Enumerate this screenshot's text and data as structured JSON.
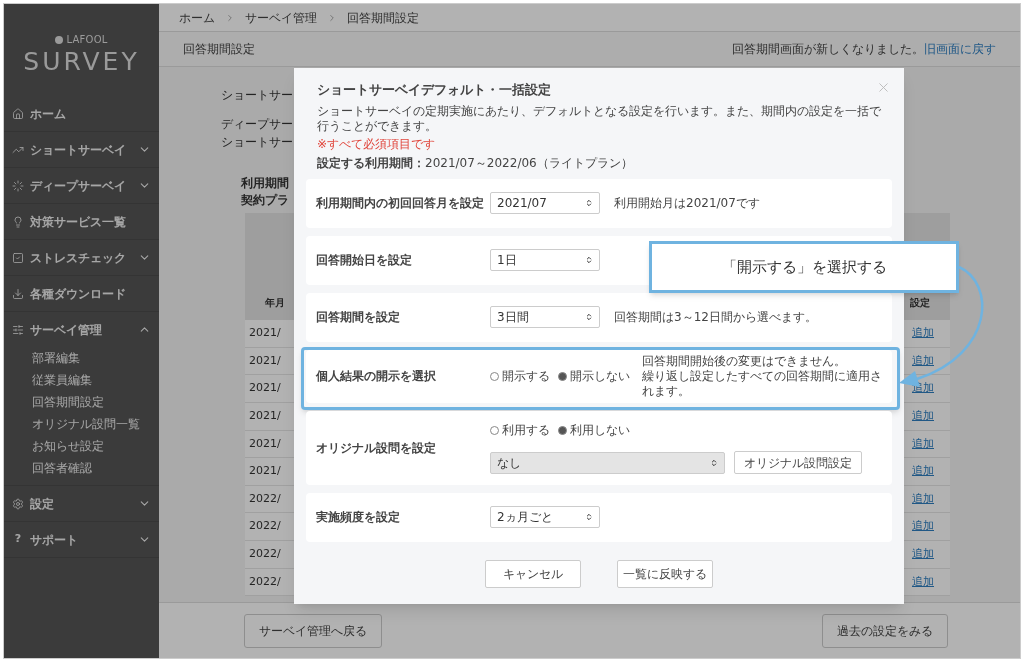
{
  "logo": {
    "brand": "LAFOOL",
    "product": "SURVEY"
  },
  "sidebar": {
    "items": [
      {
        "label": "ホーム"
      },
      {
        "label": "ショートサーベイ",
        "expanded": false
      },
      {
        "label": "ディープサーベイ",
        "expanded": false
      },
      {
        "label": "対策サービス一覧"
      },
      {
        "label": "ストレスチェック",
        "expanded": false
      },
      {
        "label": "各種ダウンロード"
      },
      {
        "label": "サーベイ管理",
        "expanded": true,
        "children": [
          {
            "label": "部署編集"
          },
          {
            "label": "従業員編集"
          },
          {
            "label": "回答期間設定"
          },
          {
            "label": "オリジナル設問一覧"
          },
          {
            "label": "お知らせ設定"
          },
          {
            "label": "回答者確認"
          }
        ]
      },
      {
        "label": "設定",
        "expanded": false
      },
      {
        "label": "サポート",
        "glyph": "?",
        "expanded": false
      }
    ]
  },
  "breadcrumb": [
    "ホーム",
    "サーベイ管理",
    "回答期間設定"
  ],
  "page_title": "回答期間設定",
  "notice": {
    "text": "回答期間画面が新しくなりました。",
    "link": "旧画面に戻す"
  },
  "background": {
    "lines": [
      "ショートサー",
      "ディープサー",
      "ショートサー"
    ],
    "plan_lines": [
      "利用期間",
      "契約プラ"
    ],
    "table": {
      "columns": [
        "年月",
        "設定"
      ],
      "rows": [
        {
          "month": "2021/",
          "action": "追加"
        },
        {
          "month": "2021/",
          "action": "追加"
        },
        {
          "month": "2021/",
          "action": "追加"
        },
        {
          "month": "2021/",
          "action": "追加"
        },
        {
          "month": "2021/",
          "action": "追加"
        },
        {
          "month": "2021/",
          "action": "追加"
        },
        {
          "month": "2022/",
          "action": "追加"
        },
        {
          "month": "2022/",
          "action": "追加"
        },
        {
          "month": "2022/",
          "action": "追加"
        },
        {
          "month": "2022/",
          "action": "追加"
        }
      ]
    },
    "buttons": [
      "サーベイ管理へ戻る",
      "過去の設定をみる"
    ]
  },
  "modal": {
    "title": "ショートサーベイデフォルト・一括設定",
    "description": "ショートサーベイの定期実施にあたり、デフォルトとなる設定を行います。また、期間内の設定を一括で行うことができます。",
    "required_note": "※すべて必須項目です",
    "period_label": "設定する利用期間：",
    "period": "2021/07～2022/06（ライトプラン）",
    "rows": [
      {
        "kind": "select",
        "label": "利用期間内の初回回答月を設定",
        "value": "2021/07",
        "notes": [
          "利用開始月は2021/07です"
        ],
        "highlighted": false
      },
      {
        "kind": "select",
        "label": "回答開始日を設定",
        "value": "1日",
        "highlighted": false
      },
      {
        "kind": "select",
        "label": "回答期間を設定",
        "value": "3日間",
        "notes": [
          "回答期間は3～12日間から選べます。"
        ],
        "highlighted": false
      },
      {
        "kind": "radio",
        "label": "個人結果の開示を選択",
        "options": [
          {
            "label": "開示する",
            "selected": false
          },
          {
            "label": "開示しない",
            "selected": true
          }
        ],
        "notes": [
          "回答期間開始後の変更はできません。",
          "繰り返し設定したすべての回答期間に適用されます。"
        ],
        "highlighted": true
      },
      {
        "kind": "radio_select",
        "label": "オリジナル設問を設定",
        "options": [
          {
            "label": "利用する",
            "selected": false
          },
          {
            "label": "利用しない",
            "selected": true
          }
        ],
        "value": "なし",
        "disabled": true,
        "button": "オリジナル設問設定",
        "highlighted": false
      },
      {
        "kind": "select",
        "label": "実施頻度を設定",
        "value": "2ヵ月ごと",
        "highlighted": false
      }
    ],
    "buttons": [
      "キャンセル",
      "一覧に反映する"
    ]
  },
  "callout": {
    "text": "「開示する」を選択する"
  }
}
